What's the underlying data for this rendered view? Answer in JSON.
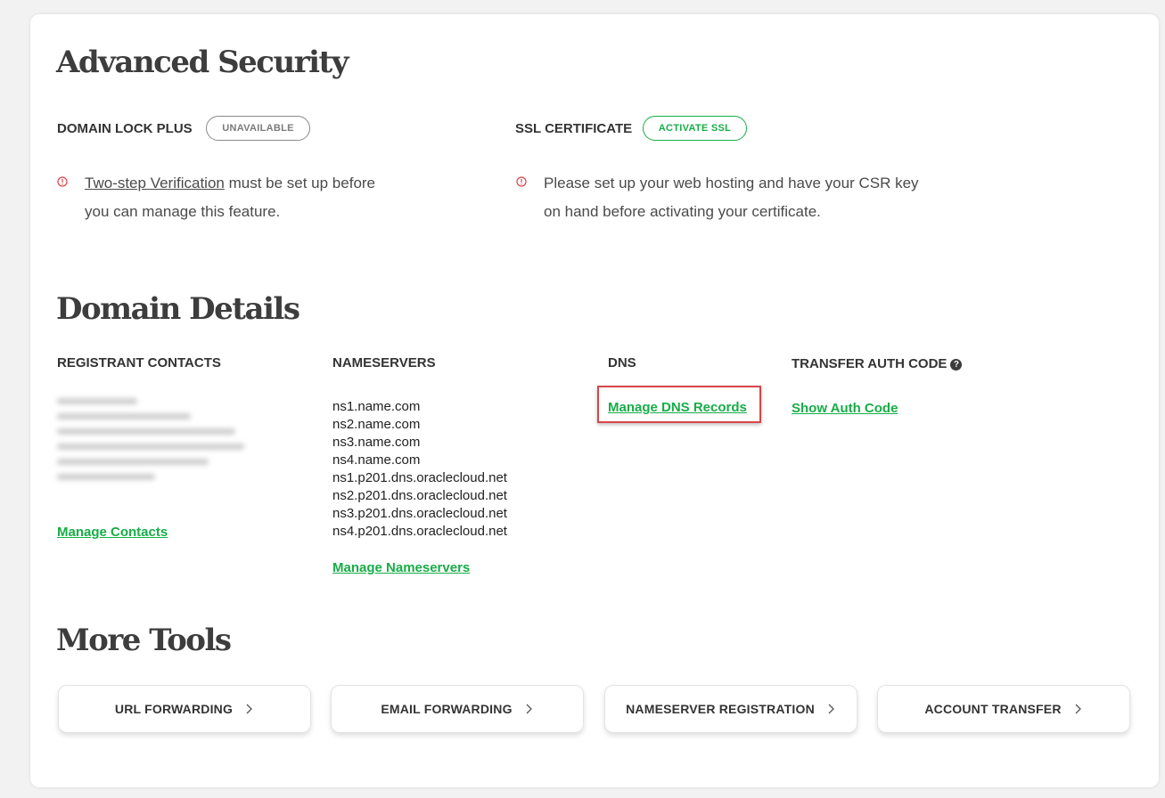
{
  "advanced_security": {
    "title": "Advanced Security",
    "domain_lock": {
      "label": "DOMAIN LOCK PLUS",
      "badge": "UNAVAILABLE",
      "notice_link": "Two-step Verification",
      "notice_line1_rest": " must be set up before",
      "notice_line2": "you can manage this feature."
    },
    "ssl": {
      "label": "SSL CERTIFICATE",
      "badge": "ACTIVATE SSL",
      "notice_line1": "Please set up your web hosting and have your CSR key",
      "notice_line2": "on hand before activating your certificate."
    }
  },
  "domain_details": {
    "title": "Domain Details",
    "registrant": {
      "label": "REGISTRANT CONTACTS",
      "manage_link": "Manage Contacts"
    },
    "nameservers": {
      "label": "NAMESERVERS",
      "list": [
        "ns1.name.com",
        "ns2.name.com",
        "ns3.name.com",
        "ns4.name.com",
        "ns1.p201.dns.oraclecloud.net",
        "ns2.p201.dns.oraclecloud.net",
        "ns3.p201.dns.oraclecloud.net",
        "ns4.p201.dns.oraclecloud.net"
      ],
      "manage_link": "Manage Nameservers"
    },
    "dns": {
      "label": "DNS",
      "manage_link": "Manage DNS Records"
    },
    "transfer": {
      "label": "TRANSFER AUTH CODE",
      "help_icon": "?",
      "link": "Show Auth Code"
    }
  },
  "more_tools": {
    "title": "More Tools",
    "buttons": [
      {
        "label": "URL FORWARDING"
      },
      {
        "label": "EMAIL FORWARDING"
      },
      {
        "label": "NAMESERVER REGISTRATION"
      },
      {
        "label": "ACCOUNT TRANSFER"
      }
    ]
  },
  "colors": {
    "accent_green": "#17ad47",
    "warning_red": "#d9454b",
    "highlight_border": "#d9454b"
  },
  "icons": {
    "warning": "alert-circle-icon",
    "help": "question-circle-icon",
    "chevron": "chevron-right-icon"
  }
}
